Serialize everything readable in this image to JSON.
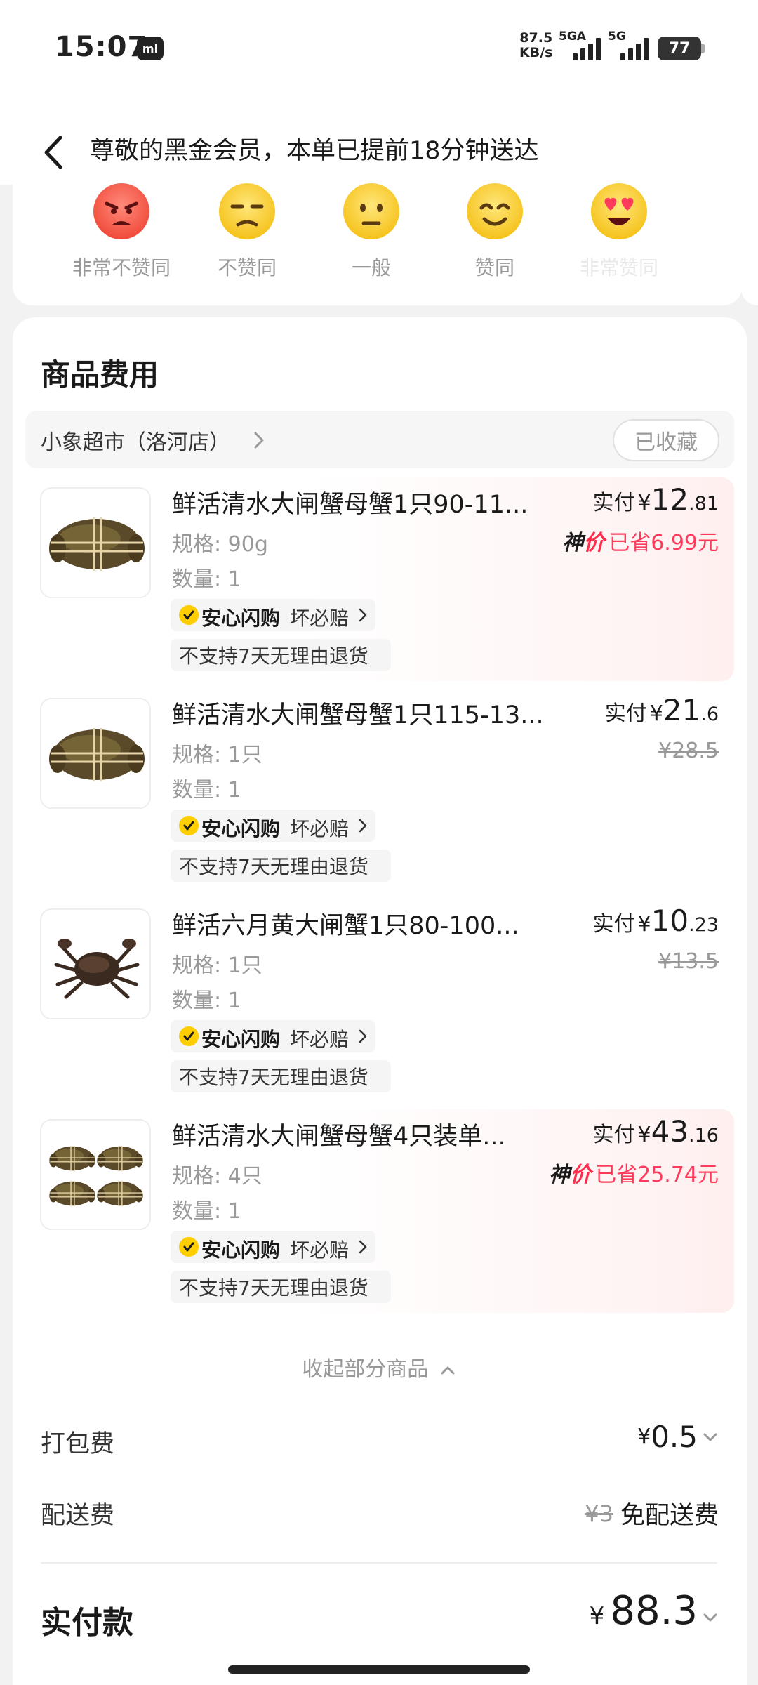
{
  "status_bar": {
    "time": "15:07",
    "mi_badge": "mi",
    "net_speed_value": "87.5",
    "net_speed_unit": "KB/s",
    "signal1_label": "5GA",
    "signal2_label": "5G",
    "battery": "77"
  },
  "header": {
    "title": "尊敬的黑金会员，本单已提前18分钟送达"
  },
  "rating": {
    "options": [
      {
        "label": "非常不赞同"
      },
      {
        "label": "不赞同"
      },
      {
        "label": "一般"
      },
      {
        "label": "赞同"
      },
      {
        "label": "非常赞同"
      }
    ]
  },
  "section": {
    "title": "商品费用",
    "store_name": "小象超市（洛河店）",
    "favorite_label": "已收藏"
  },
  "products": [
    {
      "title": "鲜活清水大闸蟹母蟹1只90-11...",
      "spec": "规格: 90g",
      "qty": "数量: 1",
      "assure_brand": "安心闪购",
      "assure_text": "坏必赔",
      "no_return": "不支持7天无理由退货",
      "paid_label": "实付",
      "currency": "¥",
      "price_int": "12",
      "price_dec": ".81",
      "promo_tag_a": "神",
      "promo_tag_b": "价",
      "saved": "已省6.99元"
    },
    {
      "title": "鲜活清水大闸蟹母蟹1只115-13...",
      "spec": "规格: 1只",
      "qty": "数量: 1",
      "assure_brand": "安心闪购",
      "assure_text": "坏必赔",
      "no_return": "不支持7天无理由退货",
      "paid_label": "实付",
      "currency": "¥",
      "price_int": "21",
      "price_dec": ".6",
      "original": "¥28.5"
    },
    {
      "title": "鲜活六月黄大闸蟹1只80-100...",
      "spec": "规格: 1只",
      "qty": "数量: 1",
      "assure_brand": "安心闪购",
      "assure_text": "坏必赔",
      "no_return": "不支持7天无理由退货",
      "paid_label": "实付",
      "currency": "¥",
      "price_int": "10",
      "price_dec": ".23",
      "original": "¥13.5"
    },
    {
      "title": "鲜活清水大闸蟹母蟹4只装单...",
      "spec": "规格: 4只",
      "qty": "数量: 1",
      "assure_brand": "安心闪购",
      "assure_text": "坏必赔",
      "no_return": "不支持7天无理由退货",
      "paid_label": "实付",
      "currency": "¥",
      "price_int": "43",
      "price_dec": ".16",
      "promo_tag_a": "神",
      "promo_tag_b": "价",
      "saved": "已省25.74元"
    }
  ],
  "collapse_label": "收起部分商品",
  "fees": {
    "packing_label": "打包费",
    "packing_currency": "¥",
    "packing_value": "0.5",
    "delivery_label": "配送费",
    "delivery_original": "¥3",
    "delivery_value": "免配送费"
  },
  "total": {
    "label": "实付款",
    "currency": "¥",
    "value": "88.3"
  },
  "colors": {
    "accent_red": "#ff3b5c",
    "badge_yellow": "#ffce00"
  }
}
